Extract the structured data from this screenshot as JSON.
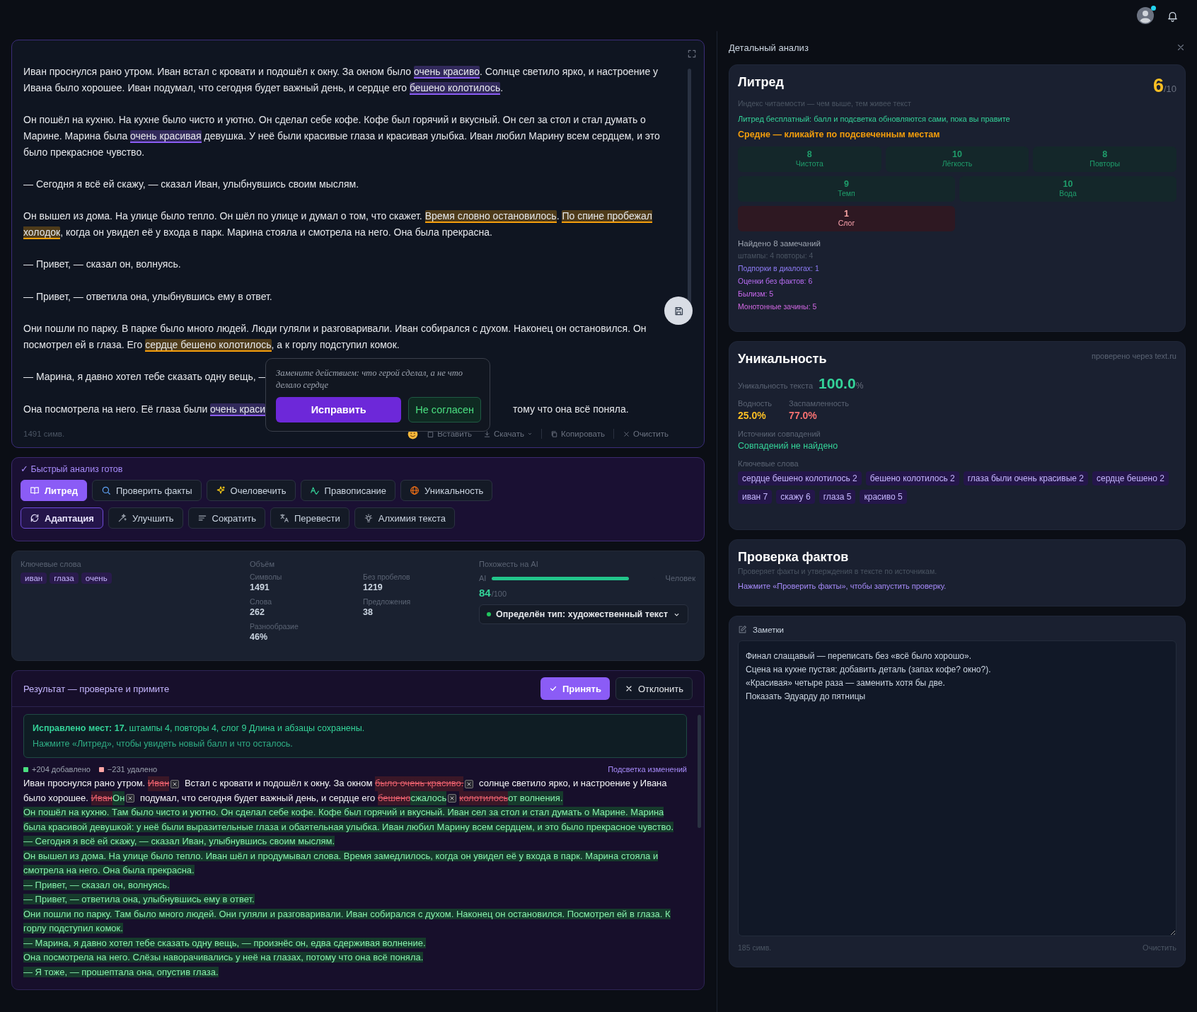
{
  "topbar": {
    "avatar": {
      "online": true
    }
  },
  "editor": {
    "paragraphs": [
      {
        "segments": [
          {
            "text": "Иван проснулся рано утром. Иван встал с кровати и подошёл к окну. За окном было "
          },
          {
            "text": "очень красиво",
            "color": "#8b5cf6"
          },
          {
            "text": ". Солнце светило ярко, и настроение у Ивана было хорошее. Иван подумал, что сегодня будет важный день, и сердце его "
          },
          {
            "text": "бешено колотилось",
            "color": "#8b5cf6"
          },
          {
            "text": "."
          }
        ]
      },
      {
        "segments": [
          {
            "text": "Он пошёл на кухню. На кухне было чисто и уютно. Он сделал себе кофе. Кофе был горячий и вкусный. Он сел за стол и стал думать о Марине. Марина была "
          },
          {
            "text": "очень красивая",
            "color": "#8b5cf6"
          },
          {
            "text": " девушка. У неё были красивые глаза и красивая улыбка. Иван любил Марину всем сердцем, и это было прекрасное чувство."
          }
        ]
      },
      {
        "segments": [
          {
            "text": "— Сегодня я всё ей скажу, — сказал Иван, улыбнувшись своим мыслям."
          }
        ]
      },
      {
        "segments": [
          {
            "text": "Он вышел из дома. На улице было тепло. Он шёл по улице и думал о том, что скажет. "
          },
          {
            "text": "Время словно остановилось",
            "color": "#f59e0b"
          },
          {
            "text": ". "
          },
          {
            "text": "По спине пробежал холодок",
            "color": "#f59e0b"
          },
          {
            "text": ", когда он увидел её у входа в парк. Марина стояла и смотрела на него. Она была прекрасна."
          }
        ]
      },
      {
        "segments": [
          {
            "text": "— Привет, — сказал он, волнуясь."
          }
        ]
      },
      {
        "segments": [
          {
            "text": "— Привет, — ответила она, улыбнувшись ему в ответ."
          }
        ]
      },
      {
        "segments": [
          {
            "text": "Они пошли по парку. В парке было много людей. Люди гуляли и разговаривали. Иван собирался с духом. Наконец он остановился. Он посмотрел ей в глаза. Его "
          },
          {
            "text": "сердце бешено колотилось",
            "color": "#f59e0b"
          },
          {
            "text": ", а к горлу подступил комок."
          }
        ]
      },
      {
        "segments": [
          {
            "text": "— Марина, я давно хотел тебе сказать одну вещь, —"
          }
        ]
      },
      {
        "segments": [
          {
            "text": "Она посмотрела на него. Её глаза были "
          },
          {
            "text": "очень краси",
            "color": "#8b5cf6"
          },
          {
            "text": "тому что она всё поняла.",
            "covered_before": true
          }
        ]
      }
    ],
    "popup": {
      "hint": "Замените действием: что герой сделал, а не что делало сердце",
      "apply": "Исправить",
      "reject": "Не согласен"
    },
    "char_count": "1491 симв.",
    "actions": [
      "Вставить",
      "Скачать",
      "Копировать",
      "Очистить"
    ]
  },
  "quick_analysis": {
    "status": "✓ Быстрый анализ готов",
    "tools": [
      {
        "label": "Литред",
        "selected": true
      },
      {
        "label": "Проверить факты",
        "selected": false
      },
      {
        "label": "Очеловечить",
        "selected": false
      },
      {
        "label": "Правописание",
        "selected": false
      },
      {
        "label": "Уникальность",
        "selected": false
      }
    ],
    "edit_tools": [
      {
        "label": "Адаптация",
        "selected": true
      },
      {
        "label": "Улучшить",
        "selected": false
      },
      {
        "label": "Сократить",
        "selected": false
      },
      {
        "label": "Перевести",
        "selected": false
      },
      {
        "label": "Алхимия текста",
        "selected": false
      }
    ]
  },
  "stats": {
    "keywords": {
      "title": "Ключевые слова",
      "items": [
        "иван",
        "глаза",
        "очень"
      ]
    },
    "volume": {
      "title": "Объём",
      "items": [
        {
          "label": "Символы",
          "value": "1491"
        },
        {
          "label": "Без пробелов",
          "value": "1219"
        },
        {
          "label": "Слова",
          "value": "262"
        },
        {
          "label": "Предложения",
          "value": "38"
        },
        {
          "label": "Разнообразие",
          "value": "46%"
        }
      ]
    },
    "ai": {
      "title": "Похожесть на AI",
      "left": "AI",
      "right": "Человек",
      "level": 0.84,
      "score": "84",
      "max": "/100",
      "type": "Определён тип: художественный текст"
    }
  },
  "result": {
    "title": "Результат — проверьте и примите",
    "accept": "Принять",
    "decline": "Отклонить",
    "summary": [
      "**Исправлено мест: 17.** штампы 4, повторы 4, слог 9 Длина и абзацы сохранены.",
      "Нажмите «Литред», чтобы увидеть новый балл и что осталось."
    ],
    "added": "+204 добавлено",
    "removed": "−231 удалено",
    "highlight_link": "Подсветка изменений",
    "diff": [
      {
        "segments": [
          {
            "kind": "same",
            "text": "Иван проснулся рано утром. "
          },
          {
            "kind": "deleted",
            "text": "Иван"
          },
          {
            "kind": "undo"
          },
          {
            "kind": "same",
            "text": " Встал с кровати и подошёл к окну. За окном "
          },
          {
            "kind": "deleted",
            "text": "было очень красиво."
          },
          {
            "kind": "undo"
          },
          {
            "kind": "same",
            "text": " солнце светило ярко, и настроение у Ивана"
          },
          {
            "kind": "same",
            "text": "было хорошее. "
          },
          {
            "kind": "deleted",
            "text": "Иван"
          },
          {
            "kind": "added",
            "text": "Он"
          },
          {
            "kind": "undo"
          },
          {
            "kind": "same",
            "text": " подумал, что сегодня будет важный день, и сердце его "
          },
          {
            "kind": "deleted",
            "text": "бешено"
          },
          {
            "kind": "added",
            "text": "сжалось"
          },
          {
            "kind": "undo"
          },
          {
            "kind": "deleted",
            "text": "колотилось"
          },
          {
            "kind": "added",
            "text": "от волнения."
          }
        ]
      },
      {
        "segments": [
          {
            "kind": "added",
            "text": "Он пошёл на кухню. Там было чисто и уютно. Он сделал себе кофе. Кофе был горячий и вкусный. Иван сел за стол и стал думать о Марине. Марина была красивой девушкой: у неё были выразительные глаза и обаятельная улыбка. Иван любил Марину всем сердцем, и это было прекрасное чувство."
          }
        ]
      },
      {
        "segments": [
          {
            "kind": "added",
            "text": "— Сегодня я всё ей скажу, — сказал Иван, улыбнувшись своим мыслям."
          }
        ]
      },
      {
        "segments": [
          {
            "kind": "added",
            "text": "Он вышел из дома. На улице было тепло. Иван шёл и продумывал слова. Время замедлилось, когда он увидел её у входа в парк. Марина стояла и смотрела на него. Она была прекрасна."
          }
        ]
      },
      {
        "segments": [
          {
            "kind": "added",
            "text": "— Привет, — сказал он, волнуясь."
          }
        ]
      },
      {
        "segments": [
          {
            "kind": "added",
            "text": "— Привет, — ответила она, улыбнувшись ему в ответ."
          }
        ]
      },
      {
        "segments": [
          {
            "kind": "added",
            "text": "Они пошли по парку. Там было много людей. Они гуляли и разговаривали. Иван собирался с духом. Наконец он остановился. Посмотрел ей в глаза. К горлу подступил комок."
          }
        ]
      },
      {
        "segments": [
          {
            "kind": "added",
            "text": "— Марина, я давно хотел тебе сказать одну вещь, — произнёс он, едва сдерживая волнение."
          }
        ]
      },
      {
        "segments": [
          {
            "kind": "added",
            "text": "Она посмотрела на него. Слёзы наворачивались у неё на глазах, потому что она всё поняла."
          }
        ]
      },
      {
        "segments": [
          {
            "kind": "added",
            "text": "— Я тоже, — прошептала она, опустив глаза."
          }
        ]
      }
    ]
  },
  "panel": {
    "title": "Детальный анализ",
    "litred": {
      "title": "Литред",
      "score": "6",
      "max": "/10",
      "subtitle": "Индекс читаемости — чем выше, тем живее текст",
      "note": "Литред бесплатный: балл и подсветка обновляются сами, пока вы правите",
      "verdict": "Средне — кликайте по подсвеченным местам",
      "metrics": [
        {
          "value": "8",
          "label": "Чистота",
          "low": false
        },
        {
          "value": "10",
          "label": "Лёгкость",
          "low": false
        },
        {
          "value": "8",
          "label": "Повторы",
          "low": false
        },
        {
          "value": "9",
          "label": "Темп",
          "low": false
        },
        {
          "value": "10",
          "label": "Вода",
          "low": false
        },
        {
          "value": "1",
          "label": "Слог",
          "low": true
        }
      ],
      "found": "Найдено 8 замечаний",
      "counts": "штампы: 4 повторы: 4",
      "issues": [
        {
          "text": "Подпорки в диалогах: 1",
          "color": "#8f7cf7"
        },
        {
          "text": "Оценки без фактов: 6",
          "color": "#b76cf2"
        },
        {
          "text": "Былизм: 5",
          "color": "#c968ee"
        },
        {
          "text": "Монотонные зачины: 5",
          "color": "#d368e4"
        }
      ]
    },
    "uniqueness": {
      "title": "Уникальность",
      "source": "проверено через text.ru",
      "label": "Уникальность текста",
      "value": "100.0",
      "unit": "%",
      "metrics": [
        {
          "label": "Водность",
          "value": "25.0%",
          "color": "#fbbf24"
        },
        {
          "label": "Заспамленность",
          "value": "77.0%",
          "color": "#f87171"
        }
      ],
      "sources_title": "Источники совпадений",
      "sources": "Совпадений не найдено",
      "keywords_title": "Ключевые слова",
      "keywords": [
        {
          "text": "сердце бешено колотилось",
          "count": "2"
        },
        {
          "text": "бешено колотилось",
          "count": "2"
        },
        {
          "text": "глаза были очень красивые",
          "count": "2"
        },
        {
          "text": "сердце бешено",
          "count": "2"
        },
        {
          "text": "иван",
          "count": "7"
        },
        {
          "text": "скажу",
          "count": "6"
        },
        {
          "text": "глаза",
          "count": "5"
        },
        {
          "text": "красиво",
          "count": "5"
        }
      ]
    },
    "facts": {
      "title": "Проверка фактов",
      "description": "Проверяет факты и утверждения в тексте по источникам.",
      "prompt": "Нажмите «Проверить факты», чтобы запустить проверку."
    },
    "notes": {
      "title": "Заметки",
      "value": "Финал слащавый — переписать без «всё было хорошо».\nСцена на кухне пустая: добавить деталь (запах кофе? окно?).\n«Красивая» четыре раза — заменить хотя бы две.\nПоказать Эдуарду до пятницы",
      "count": "185 симв.",
      "clear": "Очистить"
    }
  }
}
